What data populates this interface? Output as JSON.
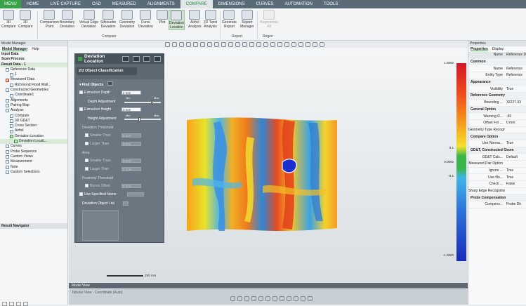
{
  "ribbon_tabs": [
    "MENU",
    "HOME",
    "LIVE CAPTURE",
    "CAD",
    "MEASURED",
    "ALIGNMENTS",
    "COMPARE",
    "DIMENSIONS",
    "CURVES",
    "AUTOMATION",
    "TOOLS"
  ],
  "active_tab": "COMPARE",
  "ribbon_buttons": {
    "compare_3d": "3D\nCompare",
    "compare_2d": "2D\nCompare",
    "comparison_point": "Comparison\nPoint",
    "boundary_deviation": "Boundary\nDeviation",
    "virtual_edge_deviation": "Virtual Edge\nDeviation",
    "silhouette_deviation": "Silhouette\nDeviation",
    "geometry_deviation": "Geometry\nDeviation",
    "curve_deviation": "Curve\nDeviation",
    "plot": "Plot",
    "deviation_location": "Deviation\nLocation",
    "airfoil_analysis": "Airfoil\nAnalysis",
    "twist_analysis_2d": "2D Twist\nAnalysis",
    "generate_report": "Generate\nReport",
    "report_manager": "Report\nManager",
    "regenerate": "Regenerate\nAll"
  },
  "ribbon_groups": {
    "compare": "Compare",
    "report": "Report",
    "regen": "Regen"
  },
  "left_panel": {
    "title": "Model Manager",
    "tabs": [
      "Model Manager",
      "Help"
    ],
    "tree": [
      {
        "label": "Input Data",
        "indent": 0,
        "bold": true
      },
      {
        "label": "Scan Process",
        "indent": 0,
        "bold": true
      },
      {
        "label": "Result Data - 1",
        "indent": 0,
        "bold": true,
        "highlight": true
      },
      {
        "label": "Reference Data",
        "indent": 1
      },
      {
        "label": "1",
        "indent": 2
      },
      {
        "label": "Measured Data",
        "indent": 1
      },
      {
        "label": "Richmond Flood Wall...",
        "indent": 2
      },
      {
        "label": "Constructed Geometries",
        "indent": 1
      },
      {
        "label": "Coordinate1",
        "indent": 2
      },
      {
        "label": "Alignments",
        "indent": 1
      },
      {
        "label": "Pairing Map",
        "indent": 1
      },
      {
        "label": "Analysis",
        "indent": 1
      },
      {
        "label": "Compare",
        "indent": 2
      },
      {
        "label": "3D GD&T",
        "indent": 2
      },
      {
        "label": "Cross Section",
        "indent": 2
      },
      {
        "label": "Airfoil",
        "indent": 2
      },
      {
        "label": "Deviation Location",
        "indent": 2
      },
      {
        "label": "Deviation Locati...",
        "indent": 3,
        "highlight": true
      },
      {
        "label": "Curves",
        "indent": 1
      },
      {
        "label": "Probe Sequence",
        "indent": 1
      },
      {
        "label": "Custom Views",
        "indent": 1
      },
      {
        "label": "Measurement",
        "indent": 1
      },
      {
        "label": "Note",
        "indent": 1
      },
      {
        "label": "Custom Selections",
        "indent": 1
      }
    ],
    "navigator": "Result Navigator"
  },
  "dialog": {
    "title": "Deviation Location",
    "step": "2/3 Object Classification",
    "find_objects": "Find Objects",
    "extraction_depth": {
      "label": "Extraction Depth",
      "value": "2 mm"
    },
    "depth_adjustment": "Depth Adjustment",
    "min": "Min",
    "max": "Max",
    "extraction_height": {
      "label": "Extraction Height",
      "value": "3 mm"
    },
    "height_adjustment": "Height Adjustment",
    "deviation_threshold": "Deviation Threshold",
    "smaller_than": {
      "label": "Smaller Than",
      "value": "0 mm"
    },
    "larger_than": {
      "label": "Larger Than",
      "value": "0 mm"
    },
    "area": "Area",
    "area_smaller_than": {
      "label": "Smaller Than",
      "value": "0 mm²"
    },
    "area_larger_than": {
      "label": "Larger Than",
      "value": "0 mm²"
    },
    "proximity_threshold": "Proximity Threshold",
    "bonus_offset": {
      "label": "Bonus Offset",
      "value": "0 mm"
    },
    "use_specified_name": "Use Specified Name",
    "deviation_object_list": "Deviation Object List"
  },
  "viewport": {
    "scale_text": "250 mm",
    "colorbar_labels": [
      {
        "text": "1.0000",
        "pos": 0.0
      },
      {
        "text": "0.1",
        "pos": 0.43
      },
      {
        "text": "0.0000",
        "pos": 0.5
      },
      {
        "text": "-0.1",
        "pos": 0.57
      },
      {
        "text": "-1.0000",
        "pos": 0.97
      }
    ]
  },
  "right_panel": {
    "title": "Properties",
    "tabs": [
      "Properties",
      "Display"
    ],
    "header_row": {
      "key": "Name",
      "value": "Reference D"
    },
    "rows": [
      {
        "type": "cat",
        "label": "Common"
      },
      {
        "key": "Name",
        "value": "Reference"
      },
      {
        "key": "Entity Type",
        "value": "Reference"
      },
      {
        "type": "cat",
        "label": "Appearance"
      },
      {
        "key": "Visibility",
        "value": "True"
      },
      {
        "type": "cat",
        "label": "Reference Geometry"
      },
      {
        "key": "Bounding ...",
        "value": "32227.33"
      },
      {
        "type": "cat",
        "label": "General Option"
      },
      {
        "key": "Warning R...",
        "value": "-50"
      },
      {
        "key": "Offset For ...",
        "value": "0 mm"
      },
      {
        "key": "Geometry Type Recognition",
        "value": ""
      },
      {
        "type": "cat",
        "label": "Compare Option"
      },
      {
        "key": "Use Norma...",
        "value": "True"
      },
      {
        "type": "cat",
        "label": "GD&T, Constructed Geom"
      },
      {
        "key": "GD&T Calc...",
        "value": "Default"
      },
      {
        "key": "Measured Pair Option",
        "value": ""
      },
      {
        "key": "Ignore ...",
        "value": "True"
      },
      {
        "key": "Use No...",
        "value": "True"
      },
      {
        "key": "Check ...",
        "value": "False"
      },
      {
        "key": "Sharp Edge Recognition",
        "value": ""
      },
      {
        "type": "cat",
        "label": "Probe Compensation"
      },
      {
        "key": "Compens...",
        "value": "Probe Dir"
      }
    ]
  },
  "status": {
    "model_view": "Model View",
    "tabular_view": "Tabular View - Coordinate (Auto)"
  },
  "colors": {
    "menu": "#3aa34a",
    "accent": "#2d8c3e",
    "dialog": "#5d6872"
  }
}
